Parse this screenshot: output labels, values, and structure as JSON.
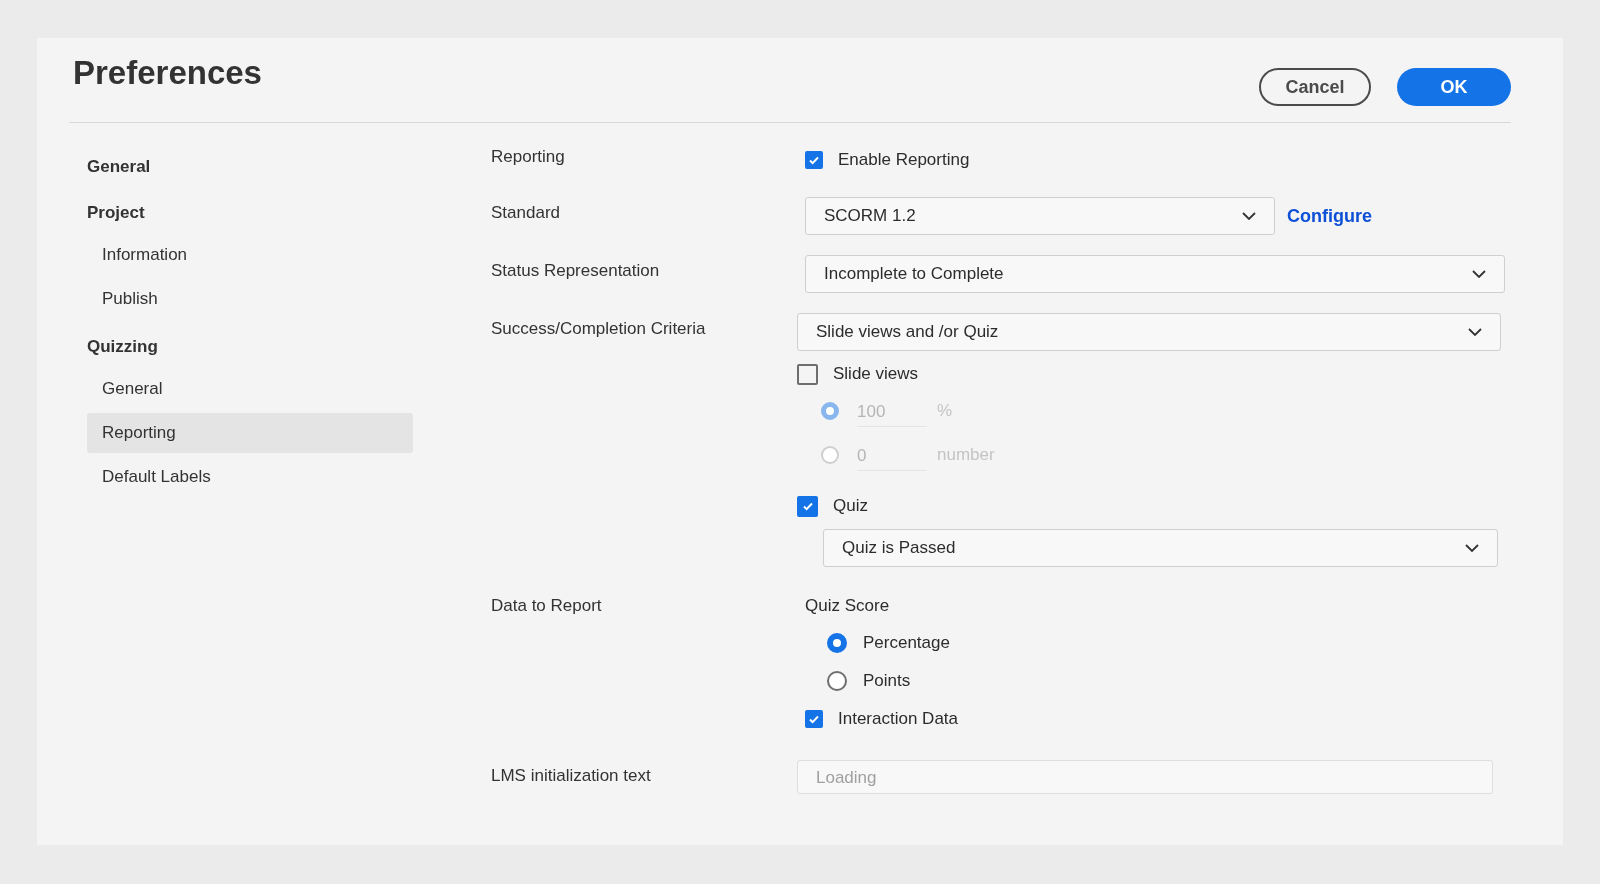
{
  "window": {
    "title": "Preferences"
  },
  "buttons": [
    {
      "kind": "secondary",
      "label": "Cancel"
    },
    {
      "kind": "primary",
      "label": "OK"
    }
  ],
  "sidebar": {
    "items": [
      {
        "label": "General",
        "selected": false
      },
      {
        "label": "Project",
        "selected": false,
        "children": [
          {
            "label": "Information",
            "selected": false
          },
          {
            "label": "Publish",
            "selected": false
          }
        ]
      },
      {
        "label": "Quizzing",
        "selected": false,
        "children": [
          {
            "label": "General",
            "selected": false
          },
          {
            "label": "Reporting",
            "selected": true
          },
          {
            "label": "Default Labels",
            "selected": false
          }
        ]
      }
    ]
  },
  "rows": [
    {
      "kind": "checkbox",
      "label": "Reporting",
      "checkbox": {
        "label": "Enable Reporting",
        "checked": true
      }
    },
    {
      "kind": "dropdown",
      "label": "Standard",
      "value": "SCORM 1.2",
      "link": "Configure"
    },
    {
      "kind": "dropdown",
      "label": "Status Representation",
      "value": "Incomplete to Complete"
    },
    {
      "kind": "criteria",
      "label": "Success/Completion Criteria",
      "value": "Slide views and /or Quiz",
      "slide_views": {
        "label": "Slide views",
        "checked": false,
        "options": [
          {
            "value": "100",
            "unit": "%",
            "selected": true,
            "disabled": true
          },
          {
            "value": "0",
            "unit": "number",
            "selected": false,
            "disabled": true
          }
        ]
      },
      "quiz": {
        "label": "Quiz",
        "checked": true,
        "value": "Quiz is Passed"
      }
    },
    {
      "kind": "data",
      "label": "Data to Report",
      "heading": "Quiz Score",
      "options": [
        {
          "label": "Percentage",
          "selected": true
        },
        {
          "label": "Points",
          "selected": false
        }
      ],
      "checkbox": {
        "label": "Interaction Data",
        "checked": true
      }
    },
    {
      "kind": "text",
      "label": "LMS initialization text",
      "placeholder": "Loading"
    }
  ]
}
